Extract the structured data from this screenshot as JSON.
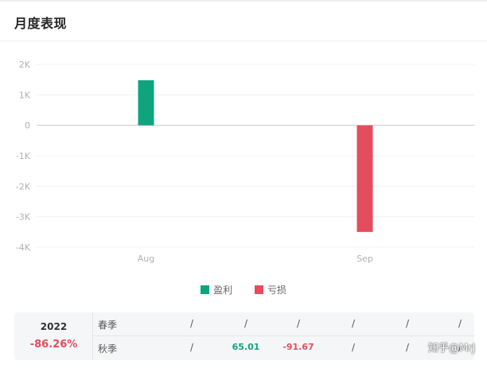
{
  "header": {
    "title": "月度表现"
  },
  "chart_data": {
    "type": "bar",
    "categories": [
      "Aug",
      "Sep"
    ],
    "series": [
      {
        "name": "盈利",
        "values": [
          1480,
          null
        ],
        "color": "#0ea57e"
      },
      {
        "name": "亏损",
        "values": [
          null,
          -3500
        ],
        "color": "#e34d5d"
      }
    ],
    "yticks": [
      {
        "value": 2000,
        "label": "2K"
      },
      {
        "value": 1000,
        "label": "1K"
      },
      {
        "value": 0,
        "label": "0"
      },
      {
        "value": -1000,
        "label": "-1K"
      },
      {
        "value": -2000,
        "label": "-2K"
      },
      {
        "value": -3000,
        "label": "-3K"
      },
      {
        "value": -4000,
        "label": "-4K"
      }
    ],
    "ylim": [
      -4000,
      2000
    ],
    "grid": true,
    "legend_position": "bottom-center"
  },
  "legend": {
    "profit": "盈利",
    "loss": "亏损",
    "profit_color": "#0ea57e",
    "loss_color": "#e34d5d"
  },
  "table": {
    "year": "2022",
    "year_return": "-86.26%",
    "rows": [
      {
        "season": "春季",
        "cells": [
          "/",
          "/",
          "/",
          "/",
          "/",
          "/"
        ]
      },
      {
        "season": "秋季",
        "cells": [
          "/",
          "65.01",
          "-91.67",
          "/",
          "/",
          "/"
        ]
      }
    ]
  },
  "watermark": "知乎@MrJ"
}
